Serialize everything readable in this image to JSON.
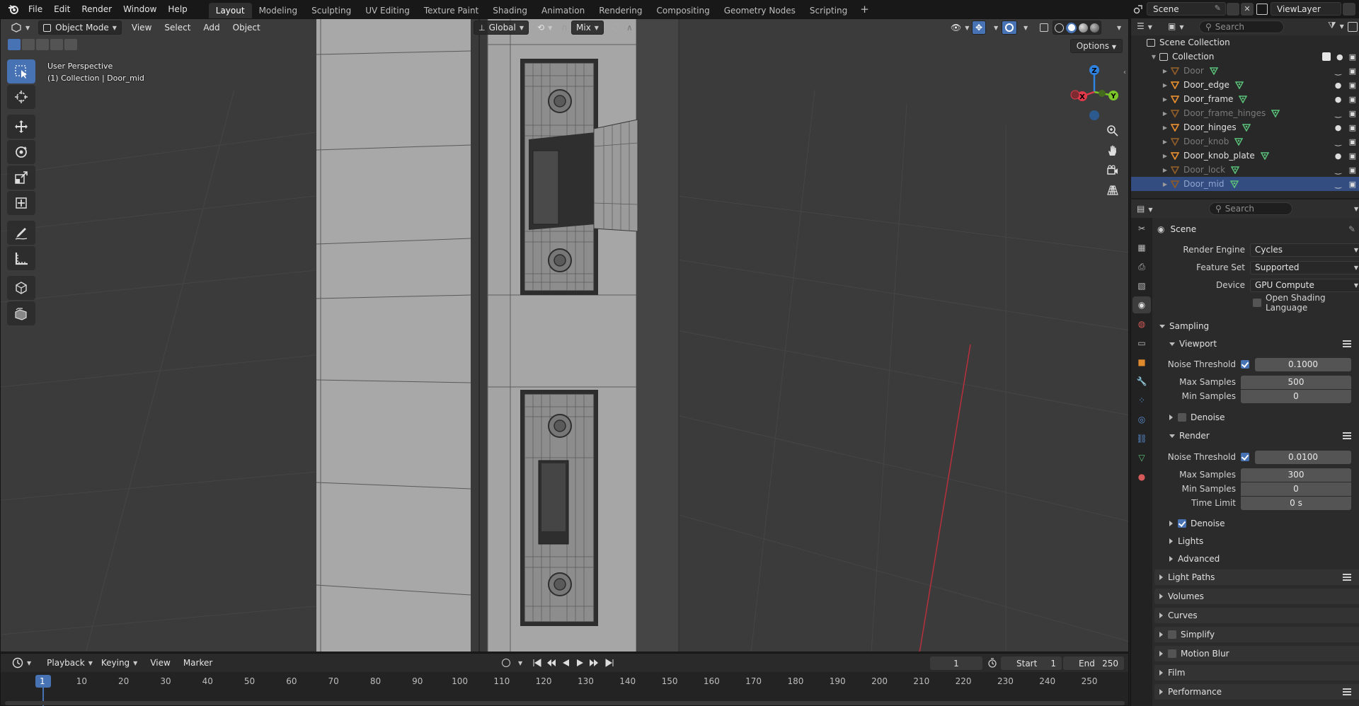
{
  "topbar": {
    "menus": [
      "File",
      "Edit",
      "Render",
      "Window",
      "Help"
    ],
    "workspaces": [
      "Layout",
      "Modeling",
      "Sculpting",
      "UV Editing",
      "Texture Paint",
      "Shading",
      "Animation",
      "Rendering",
      "Compositing",
      "Geometry Nodes",
      "Scripting"
    ],
    "active_workspace": "Layout",
    "add_tab": "+",
    "scene_name": "Scene",
    "view_layer": "ViewLayer"
  },
  "viewport": {
    "mode": "Object Mode",
    "menus": [
      "View",
      "Select",
      "Add",
      "Object"
    ],
    "transform_orientation": "Global",
    "snap_target": "Mix",
    "options_label": "Options",
    "overlay_line1": "User Perspective",
    "overlay_line2": "(1) Collection | Door_mid",
    "gizmo": {
      "x": "X",
      "y": "Y",
      "z": "Z"
    },
    "tools": [
      "select-box",
      "cursor",
      "move",
      "rotate",
      "scale",
      "transform",
      "annotate",
      "measure",
      "add-cube",
      "extrude"
    ]
  },
  "timeline": {
    "menus": [
      "Playback",
      "Keying",
      "View",
      "Marker"
    ],
    "current_frame": "1",
    "start_label": "Start",
    "start": "1",
    "end_label": "End",
    "end": "250",
    "ruler_ticks": [
      "1",
      "10",
      "20",
      "30",
      "40",
      "50",
      "60",
      "70",
      "80",
      "90",
      "100",
      "110",
      "120",
      "130",
      "140",
      "150",
      "160",
      "170",
      "180",
      "190",
      "200",
      "210",
      "220",
      "230",
      "240",
      "250"
    ]
  },
  "outliner": {
    "search_placeholder": "Search",
    "scene_collection": "Scene Collection",
    "collection": "Collection",
    "items": [
      {
        "name": "Door",
        "visible": false,
        "selected": false
      },
      {
        "name": "Door_edge",
        "visible": true,
        "selected": false
      },
      {
        "name": "Door_frame",
        "visible": true,
        "selected": false
      },
      {
        "name": "Door_frame_hinges",
        "visible": false,
        "selected": false
      },
      {
        "name": "Door_hinges",
        "visible": true,
        "selected": false
      },
      {
        "name": "Door_knob",
        "visible": false,
        "selected": false
      },
      {
        "name": "Door_knob_plate",
        "visible": true,
        "selected": false
      },
      {
        "name": "Door_lock",
        "visible": false,
        "selected": false
      },
      {
        "name": "Door_mid",
        "visible": false,
        "selected": true
      }
    ]
  },
  "properties": {
    "search_placeholder": "Search",
    "context": "Scene",
    "render_engine_label": "Render Engine",
    "render_engine": "Cycles",
    "feature_set_label": "Feature Set",
    "feature_set": "Supported",
    "device_label": "Device",
    "device": "GPU Compute",
    "osl_label": "Open Shading Language",
    "sampling": "Sampling",
    "viewport": "Viewport",
    "vp_noise_label": "Noise Threshold",
    "vp_noise": "0.1000",
    "vp_max_label": "Max Samples",
    "vp_max": "500",
    "vp_min_label": "Min Samples",
    "vp_min": "0",
    "vp_denoise": "Denoise",
    "render": "Render",
    "r_noise_label": "Noise Threshold",
    "r_noise": "0.0100",
    "r_max_label": "Max Samples",
    "r_max": "300",
    "r_min_label": "Min Samples",
    "r_min": "0",
    "r_time_label": "Time Limit",
    "r_time": "0 s",
    "r_denoise": "Denoise",
    "lights": "Lights",
    "advanced": "Advanced",
    "light_paths": "Light Paths",
    "volumes": "Volumes",
    "curves": "Curves",
    "simplify": "Simplify",
    "motion_blur": "Motion Blur",
    "film": "Film",
    "performance": "Performance"
  },
  "colors": {
    "accent": "#4772b3",
    "x_axis": "#e03a4a",
    "y_axis": "#7bc52b",
    "z_axis": "#2f83e0",
    "mesh_orange": "#e08a2e",
    "mesh_data_green": "#5bc27a"
  }
}
